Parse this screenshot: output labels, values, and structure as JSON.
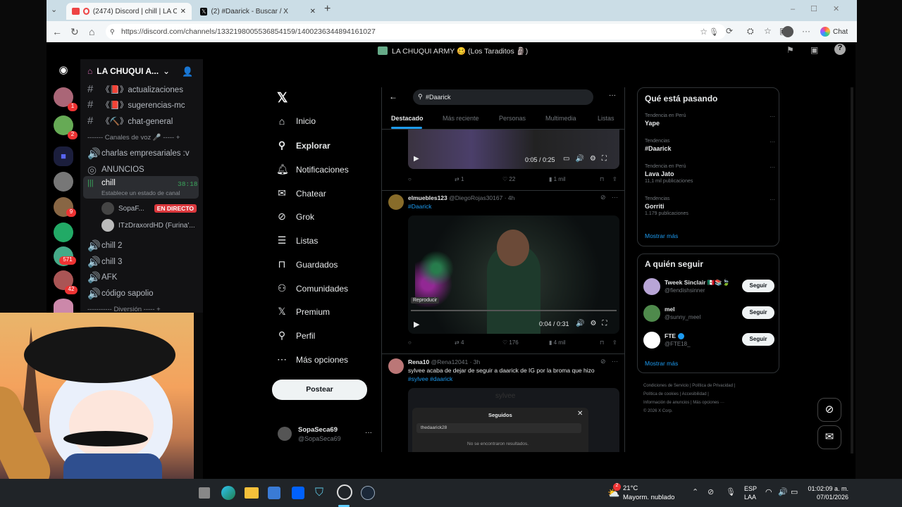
{
  "browser": {
    "tabs": [
      {
        "label": "(2474) Discord | chill | LA CHU"
      },
      {
        "label": "(2) #Daarick - Buscar / X"
      }
    ],
    "url": "https://discord.com/channels/1332198005536854159/1400236344894161027",
    "chat_label": "Chat"
  },
  "discord": {
    "server_title": "LA CHUQUI ARMY 🥴 (Los Taraditos 🗿)",
    "server_name": "LA CHUQUI A...",
    "channels": [
      {
        "name": "《📕》actualizaciones"
      },
      {
        "name": "《📕》sugerencias-mc"
      },
      {
        "name": "《⛏️》chat-general"
      }
    ],
    "voice_category": "------- Canales de voz 🎤 ----- +",
    "voice_channels": [
      {
        "name": "charlas empresariales :v"
      },
      {
        "name": "ANUNCIOS"
      }
    ],
    "chill": {
      "name": "chill",
      "time": "38:18",
      "status": "Establece un estado de canal"
    },
    "users": [
      {
        "name": "SopaF...",
        "badge": "EN DIRECTO"
      },
      {
        "name": "ITzDraxordHD (Furina'..."
      }
    ],
    "more_channels": [
      {
        "name": "chill 2"
      },
      {
        "name": "chill 3"
      },
      {
        "name": "AFK"
      },
      {
        "name": "código sapolio"
      }
    ],
    "category2": "----------- Diversión ----- +",
    "guild_badges": [
      "1",
      "2",
      "9",
      "571",
      "42"
    ]
  },
  "x": {
    "nav": [
      {
        "label": "Inicio"
      },
      {
        "label": "Explorar"
      },
      {
        "label": "Notificaciones"
      },
      {
        "label": "Chatear"
      },
      {
        "label": "Grok"
      },
      {
        "label": "Listas"
      },
      {
        "label": "Guardados"
      },
      {
        "label": "Comunidades"
      },
      {
        "label": "Premium"
      },
      {
        "label": "Perfil"
      },
      {
        "label": "Más opciones"
      }
    ],
    "post_button": "Postear",
    "account": {
      "name": "SopaSeca69",
      "handle": "@SopaSeca69"
    },
    "search_value": "#Daarick",
    "tabs": [
      "Destacado",
      "Más reciente",
      "Personas",
      "Multimedia",
      "Listas"
    ],
    "video1": {
      "time": "0:05 / 0:25",
      "replies": "",
      "reposts": "1",
      "likes": "22",
      "views": "1 mil"
    },
    "post2": {
      "user": "elmuebles123",
      "handle": "@DiegoRojas30167 · 4h",
      "tag": "#Daarick",
      "time": "0:04 / 0:31",
      "overlay": "Reproducir",
      "reposts": "4",
      "likes": "176",
      "views": "4 mil"
    },
    "post3": {
      "user": "Rena10",
      "handle": "@Rena12041 · 3h",
      "text": "sylvee acaba de dejar de seguir a daarick de IG por la broma que hizo",
      "tags": "#sylvee #daarick",
      "modal_title": "Seguidos",
      "modal_item": "thedaarick28",
      "modal_empty": "No se encontraron resultados.",
      "bg_text": "sylvee"
    },
    "trends_title": "Qué está pasando",
    "trends": [
      {
        "context": "Tendencia en Perú",
        "name": "Yape",
        "count": ""
      },
      {
        "context": "Tendencias",
        "name": "#Daarick",
        "count": ""
      },
      {
        "context": "Tendencia en Perú",
        "name": "Lava Jato",
        "count": "11,1 mil publicaciones"
      },
      {
        "context": "Tendencias",
        "name": "Gorriti",
        "count": "1.179 publicaciones"
      }
    ],
    "show_more": "Mostrar más",
    "follow_title": "A quién seguir",
    "follow": [
      {
        "name": "Tweek Sinclair 🇲🇽📚🍃",
        "handle": "@fiendishsinner",
        "btn": "Seguir"
      },
      {
        "name": "mel",
        "handle": "@sunny_meel",
        "btn": "Seguir"
      },
      {
        "name": "FTE",
        "handle": "@FTE18_",
        "btn": "Seguir"
      }
    ],
    "footer": [
      "Condiciones de Servicio",
      "Política de Privacidad",
      "Política de cookies",
      "Accesibilidad",
      "Información de anuncios",
      "Más opciones ···",
      "© 2026 X Corp."
    ]
  },
  "taskbar": {
    "weather_temp": "21°C",
    "weather_desc": "Mayorm. nublado",
    "weather_badge": "2",
    "lang1": "ESP",
    "lang2": "LAA",
    "time": "01:02:09 a. m.",
    "date": "07/01/2026"
  }
}
